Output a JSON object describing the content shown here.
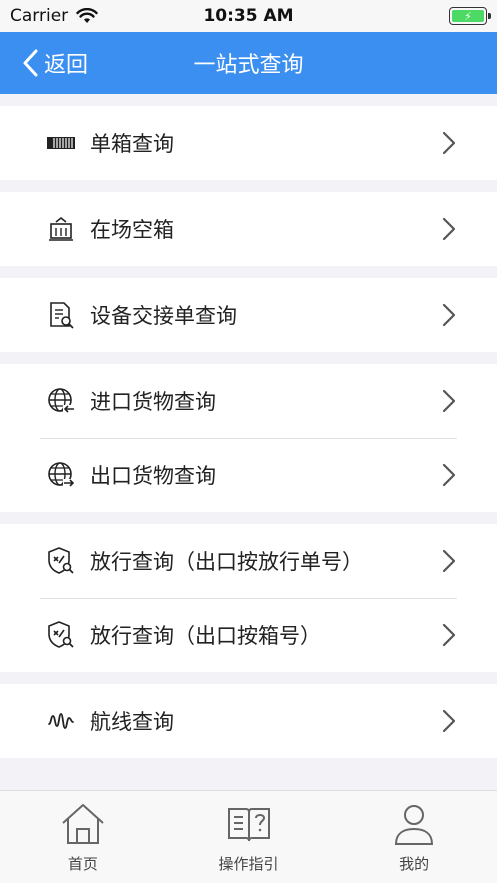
{
  "status_bar": {
    "carrier": "Carrier",
    "time": "10:35 AM",
    "battery_charging_symbol": "⚡"
  },
  "nav": {
    "back_label": "返回",
    "title": "一站式查询"
  },
  "groups": [
    {
      "items": [
        {
          "label": "单箱查询",
          "icon": "container-icon"
        }
      ]
    },
    {
      "items": [
        {
          "label": "在场空箱",
          "icon": "empty-container-icon"
        }
      ]
    },
    {
      "items": [
        {
          "label": "设备交接单查询",
          "icon": "document-search-icon"
        }
      ]
    },
    {
      "items": [
        {
          "label": "进口货物查询",
          "icon": "globe-import-icon"
        },
        {
          "label": "出口货物查询",
          "icon": "globe-export-icon"
        }
      ]
    },
    {
      "items": [
        {
          "label": "放行查询（出口按放行单号）",
          "icon": "shield-search-icon"
        },
        {
          "label": "放行查询（出口按箱号）",
          "icon": "shield-search-icon"
        }
      ]
    },
    {
      "items": [
        {
          "label": "航线查询",
          "icon": "route-icon"
        }
      ]
    }
  ],
  "tabs": [
    {
      "label": "首页",
      "icon": "home-icon"
    },
    {
      "label": "操作指引",
      "icon": "guide-book-icon"
    },
    {
      "label": "我的",
      "icon": "user-icon"
    }
  ],
  "colors": {
    "nav_background": "#3b8ff0",
    "battery": "#4cd964"
  }
}
